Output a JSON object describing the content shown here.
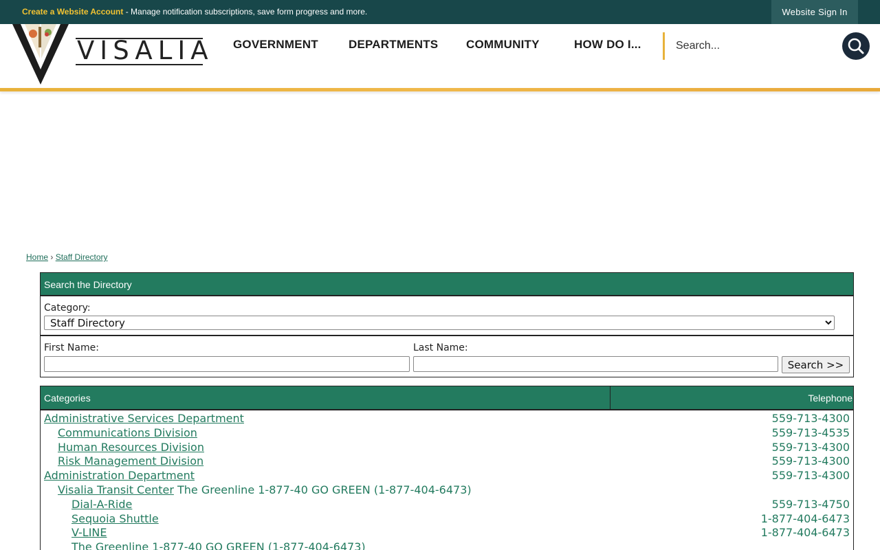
{
  "topbar": {
    "create_account_link": "Create a Website Account",
    "message": " - Manage notification subscriptions, save form progress and more.",
    "sign_in_label": "Website Sign In"
  },
  "header": {
    "logo_text": "VISALIA",
    "nav": [
      "GOVERNMENT",
      "DEPARTMENTS",
      "COMMUNITY",
      "HOW DO I..."
    ],
    "search_placeholder": "Search..."
  },
  "colors": {
    "topbar": "#18474a",
    "accent_gold": "#e8b23a",
    "green": "#237b5f",
    "search_button": "#1b2a3a"
  },
  "breadcrumb": {
    "home": "Home",
    "separator": "›",
    "current": "Staff Directory"
  },
  "directory_search": {
    "title": "Search the Directory",
    "category_label": "Category:",
    "category_selected": "Staff Directory",
    "first_name_label": "First Name:",
    "last_name_label": "Last Name:",
    "search_button": "Search >>"
  },
  "categories_table": {
    "col_categories": "Categories",
    "col_telephone": "Telephone",
    "rows": [
      {
        "level": 0,
        "name": "Administrative Services Department",
        "extra": "",
        "tel": "559-713-4300"
      },
      {
        "level": 1,
        "name": "Communications Division",
        "extra": "",
        "tel": "559-713-4535"
      },
      {
        "level": 1,
        "name": "Human Resources Division",
        "extra": "",
        "tel": "559-713-4300"
      },
      {
        "level": 1,
        "name": "Risk Management Division",
        "extra": "",
        "tel": "559-713-4300"
      },
      {
        "level": 0,
        "name": "Administration Department",
        "extra": "",
        "tel": "559-713-4300"
      },
      {
        "level": 1,
        "name": "Visalia Transit Center",
        "extra": " The Greenline 1-877-40 GO GREEN (1-877-404-6473)",
        "tel": ""
      },
      {
        "level": 2,
        "name": "Dial-A-Ride",
        "extra": "",
        "tel": "559-713-4750"
      },
      {
        "level": 2,
        "name": "Sequoia Shuttle",
        "extra": "",
        "tel": "1-877-404-6473"
      },
      {
        "level": 2,
        "name": "V-LINE",
        "extra": "",
        "tel": "1-877-404-6473"
      },
      {
        "level": 2,
        "name": "",
        "extra": "The Greenline 1-877-40 GO GREEN (1-877-404-6473)",
        "tel": ""
      }
    ]
  }
}
